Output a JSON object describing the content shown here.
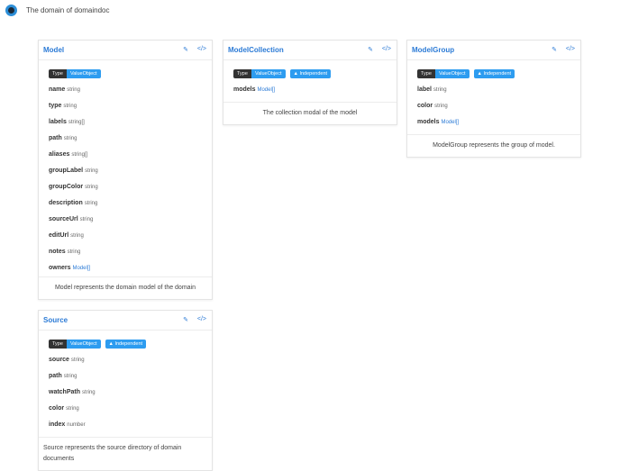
{
  "header": {
    "title": "The domain of domaindoc"
  },
  "labels": {
    "type": "Type",
    "independent": "▲ Independent",
    "edit_icon": "✎",
    "code_icon": "</>"
  },
  "cards": {
    "model": {
      "name": "Model",
      "kind": "ValueObject",
      "fields": [
        [
          "name",
          "string"
        ],
        [
          "type",
          "string"
        ],
        [
          "labels",
          "string[]"
        ],
        [
          "path",
          "string"
        ],
        [
          "aliases",
          "string[]"
        ],
        [
          "groupLabel",
          "string"
        ],
        [
          "groupColor",
          "string"
        ],
        [
          "description",
          "string"
        ],
        [
          "sourceUrl",
          "string"
        ],
        [
          "editUrl",
          "string"
        ],
        [
          "notes",
          "string"
        ],
        [
          "owners",
          "Model[]"
        ]
      ],
      "description": "Model represents the domain model of the domain"
    },
    "collection": {
      "name": "ModelCollection",
      "kind": "ValueObject",
      "fields": [
        [
          "models",
          "Model[]"
        ]
      ],
      "description": "The collection modal of the model"
    },
    "group": {
      "name": "ModelGroup",
      "kind": "ValueObject",
      "fields": [
        [
          "label",
          "string"
        ],
        [
          "color",
          "string"
        ],
        [
          "models",
          "Model[]"
        ]
      ],
      "description": "ModelGroup represents the group of model."
    },
    "source": {
      "name": "Source",
      "kind": "ValueObject",
      "fields": [
        [
          "source",
          "string"
        ],
        [
          "path",
          "string"
        ],
        [
          "watchPath",
          "string"
        ],
        [
          "color",
          "string"
        ],
        [
          "index",
          "number"
        ]
      ],
      "description": "Source represents the source directory of domain documents"
    }
  }
}
